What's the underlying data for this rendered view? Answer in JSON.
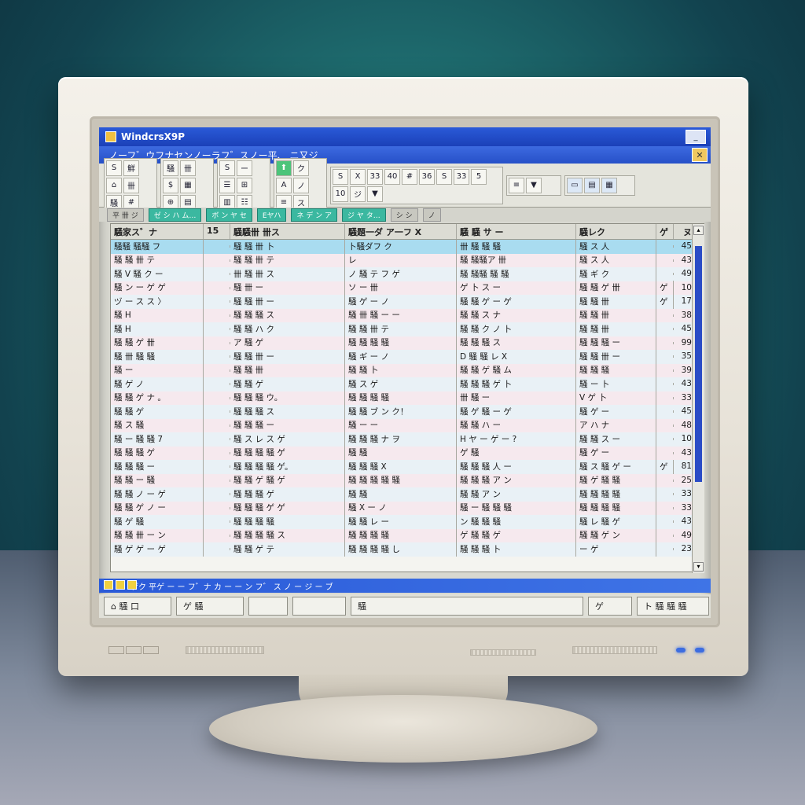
{
  "window": {
    "title": "WindcrsX9P",
    "menu_text": "ノーフ゛ウフナセンノーラフ゛スノー平、 ニ又ジ"
  },
  "toolbar": {
    "groups": [
      [
        "S",
        "鮮",
        "⌂",
        "卌",
        "騒",
        "#"
      ],
      [
        "騒",
        "卌",
        "$",
        "▦",
        "⊕",
        "▤"
      ],
      [
        "S",
        "ー",
        "☰",
        "⊞",
        "▥",
        "☷"
      ],
      [
        "⬆",
        "ク",
        "A",
        "ノ",
        "≡",
        "ス"
      ],
      [
        "S",
        "X",
        "33",
        "40",
        "#",
        "36",
        "S",
        "33",
        "5",
        "10",
        "ジ",
        "▼"
      ],
      [
        "≡",
        "▼"
      ],
      [
        "▭",
        "▤",
        "▦"
      ]
    ]
  },
  "tabs": [
    "平 卌 ジ",
    "ゼ シ ハ ム…",
    "ボ ン ヤ セ",
    "Eヤハ",
    "ネ デ ン ア",
    "ジ ヤ タ…",
    "シ シ",
    "ノ"
  ],
  "sheet": {
    "headers": [
      "騒家ス゛ナ",
      "15",
      "騒騒卌 卌ス",
      "騒題一ダ ア一フ X",
      "騒 騒 サ ー",
      "騒レク",
      "ゲ",
      "ヌ"
    ],
    "rows": [
      [
        "騒騒 騒騒 フ",
        "",
        "騒 騒 卌 卜",
        "卜騒ダフ ク",
        "卌 騒 騒 騒",
        "騒 ス 人",
        "",
        "45"
      ],
      [
        "騒 騒 卌 テ",
        "",
        "騒 騒 卌 テ",
        "レ",
        "騒 騒騒ア 卌",
        "騒 ス 人",
        "",
        "43"
      ],
      [
        "騒 V 騒 ク ー",
        "",
        "卌 騒 卌 ス",
        "ノ 騒 テ フ ゲ",
        "騒 騒騒 騒 騒",
        "騒 ギ ク",
        "",
        "49"
      ],
      [
        "騒 ン ー ゲ ゲ",
        "",
        "騒 卌 ー",
        "ソ ー 卌",
        "ゲ 卜 ス ー",
        "騒 騒 ゲ 卌",
        "ゲ",
        "10"
      ],
      [
        "ヅ ー ス ス 〉",
        "",
        "騒 騒 卌 ー",
        "騒 ゲ ー ノ",
        "騒 騒 ゲ ー ゲ",
        "騒 騒 卌",
        "ゲ",
        "17"
      ],
      [
        "騒 H",
        "",
        "騒 騒 騒 ス",
        "騒 卌 騒 ー ー",
        "騒 騒 ス ナ",
        "騒 騒 卌",
        "",
        "38"
      ],
      [
        "騒 H",
        "",
        "騒 騒 ハ ク",
        "騒 騒 卌 テ",
        "騒 騒 ク ノ 卜",
        "騒 騒 卌",
        "",
        "45"
      ],
      [
        "騒 騒 ゲ 卌",
        "",
        "ア 騒 ゲ",
        "騒 騒 騒 騒",
        "騒 騒 騒 ス",
        "騒 騒 騒 ー",
        "",
        "99"
      ],
      [
        "騒 卌 騒 騒",
        "",
        "騒 騒 卌 ー",
        "騒 ギ ー ノ",
        "D 騒 騒 レ X",
        "騒 騒 卌 ー",
        "",
        "35"
      ],
      [
        "騒 ー",
        "",
        "騒 騒 卌",
        "騒 騒 卜",
        "騒 騒 ゲ 騒 ム",
        "騒 騒 騒",
        "",
        "39"
      ],
      [
        "騒 ゲ ノ",
        "",
        "騒 騒 ゲ",
        "騒 ス ゲ",
        "騒 騒 騒 ゲ 卜",
        "騒 ー 卜",
        "",
        "43"
      ],
      [
        "騒 騒 ゲ ナ 。",
        "",
        "騒 騒 騒 ウ。",
        "騒 騒 騒 騒",
        "卌 騒 ー",
        "V ゲ 卜",
        "",
        "33"
      ],
      [
        "騒 騒 ゲ",
        "",
        "騒 騒 騒 ス",
        "騒 騒 ブ ン ク！",
        "騒 ゲ 騒 ー ゲ",
        "騒 ゲ ー",
        "",
        "45"
      ],
      [
        "騒 ス 騒",
        "",
        "騒 騒 騒 ー",
        "騒 ー ー",
        "騒 騒 ハ ー",
        "ア ハ ナ",
        "",
        "48"
      ],
      [
        "騒 ー 騒 騒 7",
        "",
        "騒 ス レ ス ゲ",
        "騒 騒 騒 ナ ヲ",
        "H ヤ ー ゲ ー ?",
        "騒 騒 ス ー",
        "",
        "10"
      ],
      [
        "騒 騒 騒 ゲ",
        "",
        "騒 騒 騒 騒 ゲ",
        "騒 騒",
        "ゲ 騒",
        "騒 ゲ ー",
        "",
        "43"
      ],
      [
        "騒 騒 騒 ー",
        "",
        "騒 騒 騒 騒 ゲ。",
        "騒 騒 騒 X",
        "騒 騒 騒 人 ー",
        "騒 ス 騒 ゲ ー",
        "ゲ",
        "81"
      ],
      [
        "騒 騒 ー 騒",
        "",
        "騒 騒 ゲ 騒 ゲ",
        "騒 騒 騒 騒 騒",
        "騒 騒 騒 ア ン",
        "騒 ゲ 騒 騒",
        "",
        "25"
      ],
      [
        "騒 騒 ノ ー ゲ",
        "",
        "騒 騒 騒 ゲ",
        "騒 騒",
        "騒 騒 ア ン",
        "騒 騒 騒 騒",
        "",
        "33"
      ],
      [
        "騒 騒 ゲ ノ ー",
        "",
        "騒 騒 騒 ゲ ゲ",
        "騒 X ー ノ",
        "騒 ー 騒 騒 騒",
        "騒 騒 騒 騒",
        "",
        "33"
      ],
      [
        "騒 ゲ 騒",
        "",
        "騒 騒 騒 騒",
        "騒 騒 レ ー",
        "ン 騒 騒 騒",
        "騒 レ 騒 ゲ",
        "",
        "43"
      ],
      [
        "騒 騒 卌 ー ン",
        "",
        "騒 騒 騒 騒 ス",
        "騒 騒 騒 騒",
        "ゲ 騒 騒 ゲ",
        "騒 騒 ゲ ン",
        "",
        "49"
      ],
      [
        "騒 ゲ ゲ ー ゲ",
        "",
        "騒 騒 ゲ テ",
        "騒 騒 騒 騒 し",
        "騒 騒 騒 卜",
        "ー ゲ",
        "",
        "23"
      ]
    ]
  },
  "statusbar": {
    "text": "ゲク 平ゲ ー ー フ゛ナ カ ー ー ン フ゛ ス ノ ー ジ ー ブ"
  },
  "bottombar": {
    "b1": "⌂ 騒 口",
    "b2": "ゲ 騒",
    "b3": "",
    "b4": "",
    "b5": "騒",
    "b6": "ゲ",
    "b7": "ト 騒 騒 騒"
  },
  "colors": {
    "titlebar": "#2a5ad8",
    "highlight_row": "#a9dcf0",
    "scroll_thumb": "#2a4cc6",
    "bezel": "#e7e2d8"
  }
}
